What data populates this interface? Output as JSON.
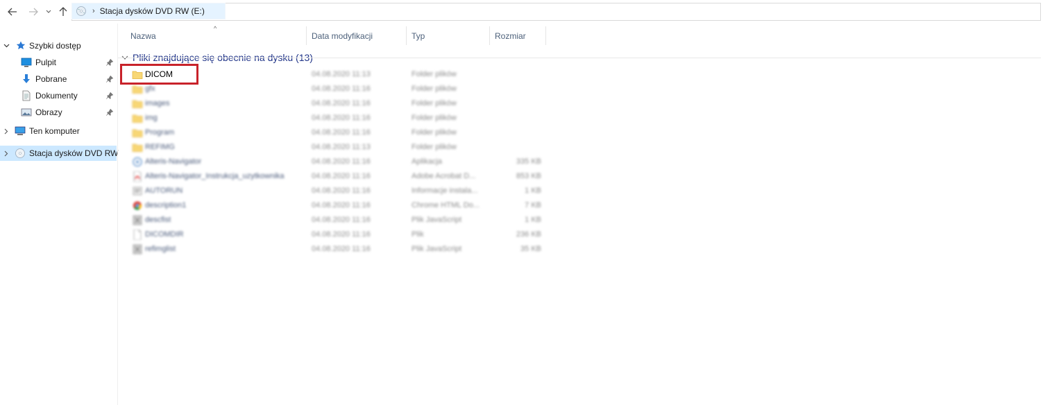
{
  "window": {
    "address": {
      "path": "Stacja dysków DVD RW (E:)"
    }
  },
  "sidebar": {
    "items": [
      {
        "label": "Szybki dostęp",
        "icon": "star-icon",
        "pinned": false
      },
      {
        "label": "Pulpit",
        "icon": "desktop-icon",
        "pinned": true
      },
      {
        "label": "Pobrane",
        "icon": "download-arrow-icon",
        "pinned": true
      },
      {
        "label": "Dokumenty",
        "icon": "document-icon",
        "pinned": true
      },
      {
        "label": "Obrazy",
        "icon": "pictures-icon",
        "pinned": true
      },
      {
        "label": "Ten komputer",
        "icon": "computer-icon",
        "pinned": false
      },
      {
        "label": "Stacja dysków DVD RW",
        "icon": "dvd-drive-icon",
        "pinned": false,
        "selected": true
      }
    ]
  },
  "columns": {
    "name": "Nazwa",
    "date": "Data modyfikacji",
    "type": "Typ",
    "size": "Rozmiar"
  },
  "group": {
    "label": "Pliki znajdujące się obecnie na dysku (13)"
  },
  "files": [
    {
      "name": "DICOM",
      "date": "04.08.2020 11:13",
      "type": "Folder plików",
      "size": "",
      "icon": "folder-icon"
    },
    {
      "name": "gfx",
      "date": "04.08.2020 11:16",
      "type": "Folder plików",
      "size": "",
      "icon": "folder-icon"
    },
    {
      "name": "images",
      "date": "04.08.2020 11:16",
      "type": "Folder plików",
      "size": "",
      "icon": "folder-icon"
    },
    {
      "name": "img",
      "date": "04.08.2020 11:16",
      "type": "Folder plików",
      "size": "",
      "icon": "folder-icon"
    },
    {
      "name": "Program",
      "date": "04.08.2020 11:16",
      "type": "Folder plików",
      "size": "",
      "icon": "folder-icon"
    },
    {
      "name": "REFIMG",
      "date": "04.08.2020 11:13",
      "type": "Folder plików",
      "size": "",
      "icon": "folder-icon"
    },
    {
      "name": "Alteris-Navigator",
      "date": "04.08.2020 11:16",
      "type": "Aplikacja",
      "size": "335 KB",
      "icon": "app-icon"
    },
    {
      "name": "Alteris-Navigator_Instrukcja_uzytkownika",
      "date": "04.08.2020 11:16",
      "type": "Adobe Acrobat D...",
      "size": "853 KB",
      "icon": "pdf-icon"
    },
    {
      "name": "AUTORUN",
      "date": "04.08.2020 11:16",
      "type": "Informacje instala...",
      "size": "1 KB",
      "icon": "setup-info-icon"
    },
    {
      "name": "description1",
      "date": "04.08.2020 11:16",
      "type": "Chrome HTML Do...",
      "size": "7 KB",
      "icon": "chrome-icon"
    },
    {
      "name": "descfist",
      "date": "04.08.2020 11:16",
      "type": "Plik JavaScript",
      "size": "1 KB",
      "icon": "script-icon"
    },
    {
      "name": "DICOMDIR",
      "date": "04.08.2020 11:16",
      "type": "Plik",
      "size": "236 KB",
      "icon": "blank-file-icon"
    },
    {
      "name": "refimglist",
      "date": "04.08.2020 11:16",
      "type": "Plik JavaScript",
      "size": "35 KB",
      "icon": "script-icon"
    }
  ],
  "colors": {
    "accent_selected": "#cce8ff",
    "highlight_box": "#c8222a",
    "group_text": "#1e3287",
    "folder": "#f8d775"
  }
}
